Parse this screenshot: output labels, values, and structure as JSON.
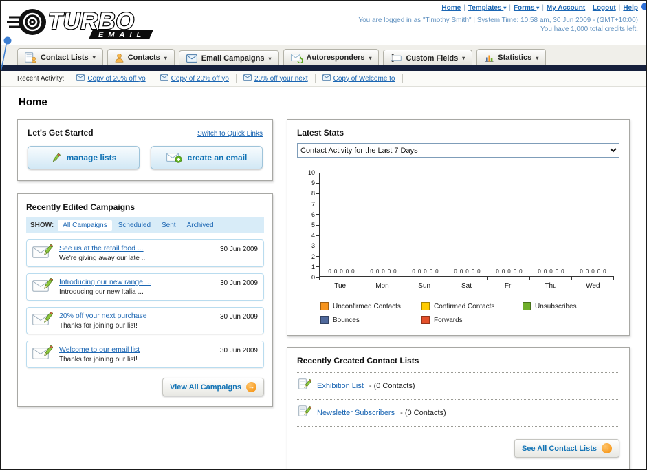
{
  "header": {
    "logo": {
      "word_main": "TURBO",
      "word_sub": "EMAIL"
    },
    "links": [
      {
        "label": "Home",
        "dropdown": false
      },
      {
        "label": "Templates",
        "dropdown": true
      },
      {
        "label": "Forms",
        "dropdown": true
      },
      {
        "label": "My Account",
        "dropdown": false
      },
      {
        "label": "Logout",
        "dropdown": false
      },
      {
        "label": "Help",
        "dropdown": false
      }
    ],
    "session_line": "You are logged in as \"Timothy Smith\" | System Time: 10:58 am, 30 Jun 2009 - (GMT+10:00)",
    "credits_line": "You have 1,000 total credits left."
  },
  "nav_tabs": [
    {
      "label": "Contact Lists",
      "icon": "contact-lists-icon"
    },
    {
      "label": "Contacts",
      "icon": "contacts-icon"
    },
    {
      "label": "Email Campaigns",
      "icon": "email-campaigns-icon"
    },
    {
      "label": "Autoresponders",
      "icon": "autoresponders-icon"
    },
    {
      "label": "Custom Fields",
      "icon": "custom-fields-icon"
    },
    {
      "label": "Statistics",
      "icon": "statistics-icon"
    }
  ],
  "recent_activity": {
    "label": "Recent Activity:",
    "items": [
      "Copy of 20% off yo",
      "Copy of 20% off yo",
      "20% off your next",
      "Copy of Welcome to"
    ]
  },
  "page_title": "Home",
  "get_started": {
    "title": "Let's Get Started",
    "switch_link": "Switch to Quick Links",
    "buttons": [
      "manage lists",
      "create an email"
    ]
  },
  "campaigns": {
    "title": "Recently Edited Campaigns",
    "show_label": "SHOW:",
    "tabs": [
      "All Campaigns",
      "Scheduled",
      "Sent",
      "Archived"
    ],
    "active_tab": "All Campaigns",
    "items": [
      {
        "title": "See us at the retail food ...",
        "subtitle": "We're giving away our late ...",
        "date": "30 Jun 2009"
      },
      {
        "title": "Introducing our new range ...",
        "subtitle": "Introducing our new Italia ...",
        "date": "30 Jun 2009"
      },
      {
        "title": "20% off your next purchase",
        "subtitle": "Thanks for joining our list!",
        "date": "30 Jun 2009"
      },
      {
        "title": "Welcome to our email list",
        "subtitle": "Thanks for joining our list!",
        "date": "30 Jun 2009"
      }
    ],
    "view_all_label": "View All Campaigns"
  },
  "stats": {
    "title": "Latest Stats",
    "dropdown_value": "Contact Activity for the Last 7 Days"
  },
  "chart_data": {
    "type": "bar",
    "title": "Contact Activity for the Last 7 Days",
    "categories": [
      "Tue",
      "Mon",
      "Sun",
      "Sat",
      "Fri",
      "Thu",
      "Wed"
    ],
    "series": [
      {
        "name": "Unconfirmed Contacts",
        "color": "#f7941d",
        "values": [
          0,
          0,
          0,
          0,
          0,
          0,
          0
        ]
      },
      {
        "name": "Confirmed Contacts",
        "color": "#ffcc00",
        "values": [
          0,
          0,
          0,
          0,
          0,
          0,
          0
        ]
      },
      {
        "name": "Unsubscribes",
        "color": "#6fae2a",
        "values": [
          0,
          0,
          0,
          0,
          0,
          0,
          0
        ]
      },
      {
        "name": "Bounces",
        "color": "#50699c",
        "values": [
          0,
          0,
          0,
          0,
          0,
          0,
          0
        ]
      },
      {
        "name": "Forwards",
        "color": "#e4502a",
        "values": [
          0,
          0,
          0,
          0,
          0,
          0,
          0
        ]
      }
    ],
    "ylim": [
      0,
      10
    ],
    "ytick_step": 1,
    "grid": false,
    "legend_position": "bottom"
  },
  "contact_lists": {
    "title": "Recently Created Contact Lists",
    "items": [
      {
        "name": "Exhibition List",
        "count": "- (0 Contacts)"
      },
      {
        "name": "Newsletter Subscribers",
        "count": "- (0 Contacts)"
      }
    ],
    "see_all_label": "See All Contact Lists"
  },
  "icons": {
    "caret_down": "▾",
    "arrow_right": "→",
    "activity_item_icon": "envelope-icon",
    "campaign_item_icon": "envelope-pencil-icon",
    "contact_list_item_icon": "pencil-list-icon"
  },
  "colors": {
    "link": "#1b66b3",
    "dark_bar": "#16203c",
    "button_text": "#1273b5",
    "arrow_badge": "#f48c06"
  }
}
